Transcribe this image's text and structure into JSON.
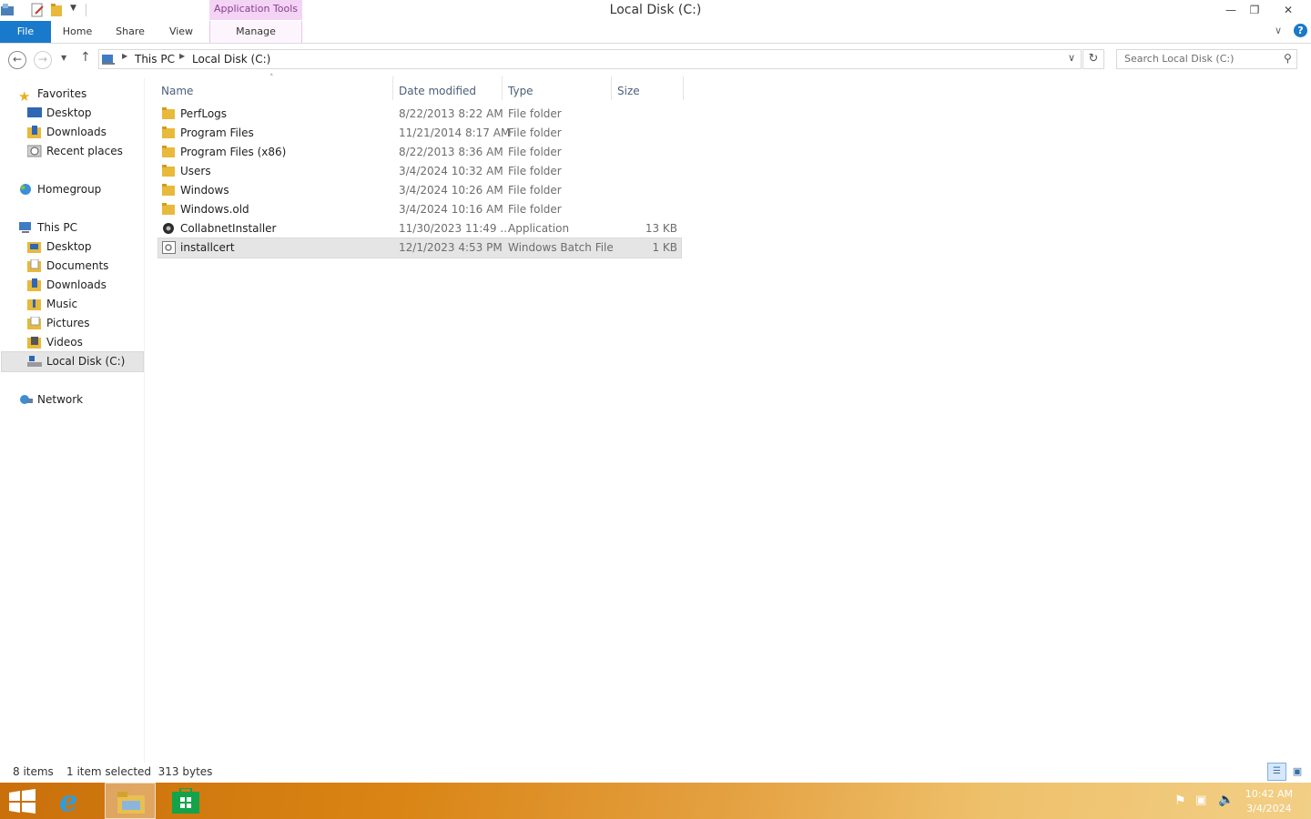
{
  "window": {
    "title": "Local Disk (C:)",
    "context_tab": "Application Tools"
  },
  "ribbon": {
    "file": "File",
    "home": "Home",
    "share": "Share",
    "view": "View",
    "manage": "Manage"
  },
  "address": {
    "crumbs": [
      "This PC",
      "Local Disk (C:)"
    ],
    "search_placeholder": "Search Local Disk (C:)"
  },
  "nav": {
    "favorites": "Favorites",
    "fav_items": [
      "Desktop",
      "Downloads",
      "Recent places"
    ],
    "homegroup": "Homegroup",
    "thispc": "This PC",
    "pc_items": [
      "Desktop",
      "Documents",
      "Downloads",
      "Music",
      "Pictures",
      "Videos",
      "Local Disk (C:)"
    ],
    "network": "Network"
  },
  "columns": {
    "name": "Name",
    "date": "Date modified",
    "type": "Type",
    "size": "Size"
  },
  "files": [
    {
      "name": "PerfLogs",
      "date": "8/22/2013 8:22 AM",
      "type": "File folder",
      "size": "",
      "icon": "folder-icon"
    },
    {
      "name": "Program Files",
      "date": "11/21/2014 8:17 AM",
      "type": "File folder",
      "size": "",
      "icon": "folder-icon"
    },
    {
      "name": "Program Files (x86)",
      "date": "8/22/2013 8:36 AM",
      "type": "File folder",
      "size": "",
      "icon": "folder-icon"
    },
    {
      "name": "Users",
      "date": "3/4/2024 10:32 AM",
      "type": "File folder",
      "size": "",
      "icon": "folder-icon"
    },
    {
      "name": "Windows",
      "date": "3/4/2024 10:26 AM",
      "type": "File folder",
      "size": "",
      "icon": "folder-icon"
    },
    {
      "name": "Windows.old",
      "date": "3/4/2024 10:16 AM",
      "type": "File folder",
      "size": "",
      "icon": "folder-icon"
    },
    {
      "name": "CollabnetInstaller",
      "date": "11/30/2023 11:49 ...",
      "type": "Application",
      "size": "13 KB",
      "icon": "application-icon"
    },
    {
      "name": "installcert",
      "date": "12/1/2023 4:53 PM",
      "type": "Windows Batch File",
      "size": "1 KB",
      "icon": "batch-file-icon"
    }
  ],
  "status": {
    "items": "8 items",
    "selected": "1 item selected  313 bytes"
  },
  "taskbar": {
    "time": "10:42 AM",
    "date": "3/4/2024"
  },
  "colors": {
    "accent": "#1979ca",
    "context_tab": "#f3d4f5",
    "taskbar": "#d98414"
  }
}
